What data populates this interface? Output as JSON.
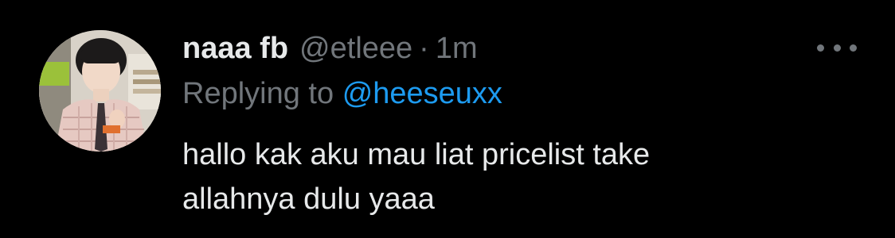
{
  "tweet": {
    "display_name": "naaa fb",
    "handle": "@etleee",
    "separator": "·",
    "time": "1m",
    "replying_prefix": "Replying to",
    "replying_to": "@heeseuxx",
    "text_lines": [
      "hallo kak aku mau liat pricelist take",
      "allahnya dulu yaaa"
    ]
  },
  "icons": {
    "avatar": "profile-photo",
    "more": "more-horizontal-icon"
  },
  "colors": {
    "background": "#000000",
    "primary_text": "#e7e9ea",
    "secondary_text": "#71767b",
    "link": "#1d9bf0"
  }
}
